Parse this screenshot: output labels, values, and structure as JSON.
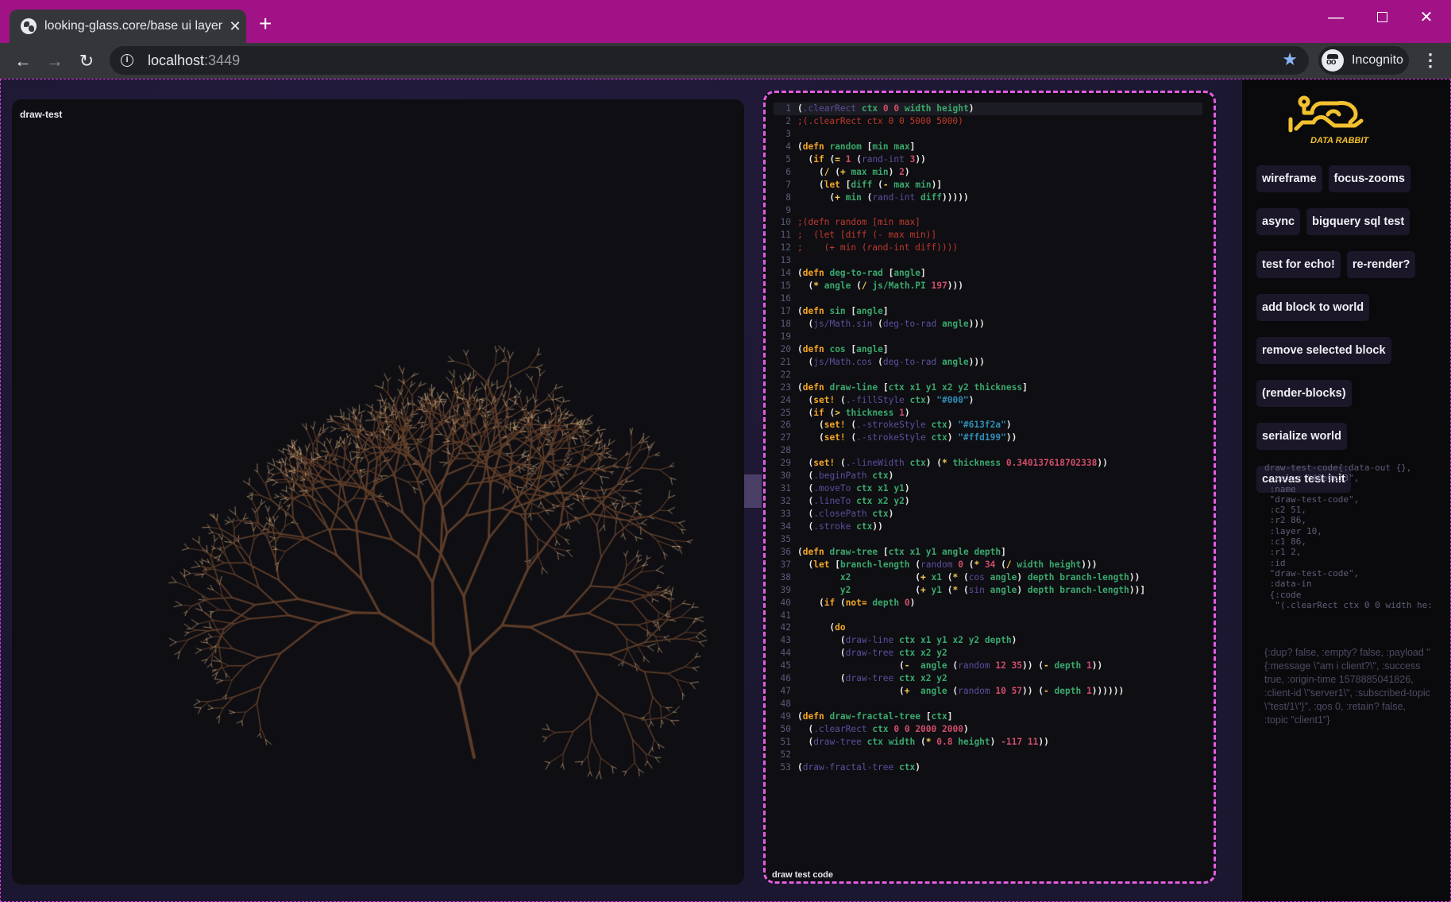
{
  "browser": {
    "tab_title": "looking-glass.core/base ui layer",
    "tab_icon": "globe-icon",
    "url_host": "localhost",
    "url_port": ":3449",
    "profile_label": "Incognito",
    "new_tab_symbol": "+",
    "close_symbol": "✕",
    "bookmark_symbol": "★",
    "menu_symbol": "⋮",
    "back_symbol": "←",
    "forward_symbol": "→",
    "reload_symbol": "↻",
    "minimize_symbol": "—"
  },
  "canvas": {
    "label": "draw-test",
    "stroke_colors": {
      "thick": "#613f2a",
      "thin": "#ffd199"
    },
    "background": "#0e0e13"
  },
  "code_panel": {
    "label": "draw test code",
    "lines": [
      "(.clearRect ctx 0 0 width height)",
      ";(.clearRect ctx 0 0 5000 5000)",
      "",
      "(defn random [min max]",
      "  (if (= 1 (rand-int 3))",
      "    (/ (+ max min) 2)",
      "    (let [diff (- max min)]",
      "      (+ min (rand-int diff)))))",
      "",
      ";(defn random [min max]",
      ";  (let [diff (- max min)]",
      ";    (+ min (rand-int diff))))",
      "",
      "(defn deg-to-rad [angle]",
      "  (* angle (/ js/Math.PI 197)))",
      "",
      "(defn sin [angle]",
      "  (js/Math.sin (deg-to-rad angle)))",
      "",
      "(defn cos [angle]",
      "  (js/Math.cos (deg-to-rad angle)))",
      "",
      "(defn draw-line [ctx x1 y1 x2 y2 thickness]",
      "  (set! (.-fillStyle ctx) \"#000\")",
      "  (if (> thickness 1)",
      "    (set! (.-strokeStyle ctx) \"#613f2a\")",
      "    (set! (.-strokeStyle ctx) \"#ffd199\"))",
      "",
      "  (set! (.-lineWidth ctx) (* thickness 0.340137618702338))",
      "  (.beginPath ctx)",
      "  (.moveTo ctx x1 y1)",
      "  (.lineTo ctx x2 y2)",
      "  (.closePath ctx)",
      "  (.stroke ctx))",
      "",
      "(defn draw-tree [ctx x1 y1 angle depth]",
      "  (let [branch-length (random 0 (* 34 (/ width height)))",
      "        x2            (+ x1 (* (cos angle) depth branch-length))",
      "        y2            (+ y1 (* (sin angle) depth branch-length))]",
      "    (if (not= depth 0)",
      "",
      "      (do",
      "        (draw-line ctx x1 y1 x2 y2 depth)",
      "        (draw-tree ctx x2 y2",
      "                   (-  angle (random 12 35)) (- depth 1))",
      "        (draw-tree ctx x2 y2",
      "                   (+  angle (random 10 57)) (- depth 1))))))",
      "",
      "(defn draw-fractal-tree [ctx]",
      "  (.clearRect ctx 0 0 2000 2000)",
      "  (draw-tree ctx width (* 0.8 height) -117 11))",
      "",
      "(draw-fractal-tree ctx)"
    ],
    "active_line": 1
  },
  "sidebar": {
    "logo_text": "DATA RABBIT",
    "logo_color": "#f2c12e",
    "buttons": [
      "wireframe",
      "focus-zooms",
      "async",
      "bigquery sql test",
      "test for echo!",
      "re-render?",
      "add block to world",
      "remove selected block",
      "(render-blocks)",
      "serialize world",
      "canvas test init"
    ],
    "block_dump": "draw-test-code{:data-out {},\n :color \"#0e0e13\",\n :name\n \"draw-test-code\",\n :c2 51,\n :r2 86,\n :layer 10,\n :c1 86,\n :r1 2,\n :id\n \"draw-test-code\",\n :data-in\n {:code\n  \"(.clearRect ctx 0 0 width he:",
    "mqtt_message": "{:dup? false, :empty? false, :payload \"{:message \\\"am i client?\\\", :success true, :origin-time 1578885041826, :client-id \\\"server1\\\", :subscribed-topic \\\"test/1\\\"}\", :qos 0, :retain? false, :topic \"client1\"}"
  }
}
